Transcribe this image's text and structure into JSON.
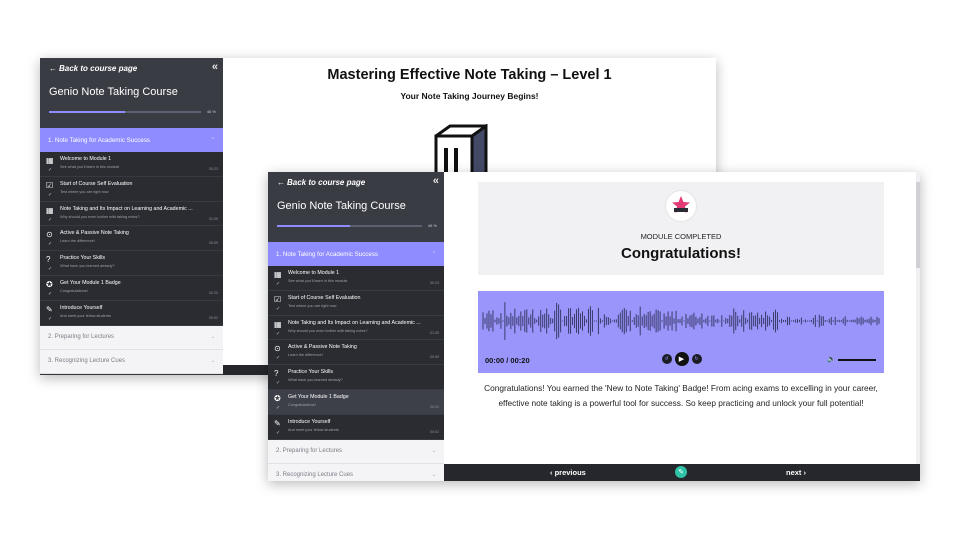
{
  "sidebar": {
    "back_link": "Back to course page",
    "course_title": "Genio Note Taking Course",
    "progress_percent": 50,
    "progress_label": "46 %",
    "active_section": "1. Note Taking for Academic Success",
    "lessons": [
      {
        "title": "Welcome to Module 1",
        "subtitle": "See what you'll learn in this module",
        "time": "00:23",
        "icon": "video-icon"
      },
      {
        "title": "Start of Course Self Evaluation",
        "subtitle": "Test where you are right now",
        "time": "",
        "icon": "checkbox-icon"
      },
      {
        "title": "Note Taking and Its Impact on Learning and Academic ...",
        "subtitle": "Why should you even bother with taking notes?",
        "time": "01:25",
        "icon": "video-icon"
      },
      {
        "title": "Active & Passive Note Taking",
        "subtitle": "Learn the difference!",
        "time": "00:59",
        "icon": "play-circle-icon"
      },
      {
        "title": "Practice Your Skills",
        "subtitle": "What have you learned already?",
        "time": "",
        "icon": "question-icon"
      },
      {
        "title": "Get Your Module 1 Badge",
        "subtitle": "Congratulations!",
        "time": "00:20",
        "icon": "badge-icon"
      },
      {
        "title": "Introduce Yourself",
        "subtitle": "And meet your fellow students",
        "time": "00:02",
        "icon": "edit-icon"
      }
    ],
    "other_sections": [
      "2. Preparing for Lectures",
      "3. Recognizing Lecture Cues"
    ]
  },
  "back_window": {
    "heading": "Mastering Effective Note Taking – Level 1",
    "subheading": "Your Note Taking Journey Begins!"
  },
  "front_window": {
    "module_completed": "MODULE COMPLETED",
    "congrats_title": "Congratulations!",
    "audio_time": "00:00 / 00:20",
    "paragraph": "Congratulations! You earned the 'New to Note Taking' Badge! From acing exams to excelling in your career, effective note taking is a powerful tool for success. So keep practicing and unlock your full potential!",
    "previous_label": "‹ previous",
    "next_label": "next ›"
  },
  "colors": {
    "accent": "#8f8cff",
    "audio_bg": "#9995fa",
    "sidebar_bg": "#33353b",
    "footer_bg": "#26272c",
    "edit_button": "#2ec3a6"
  }
}
